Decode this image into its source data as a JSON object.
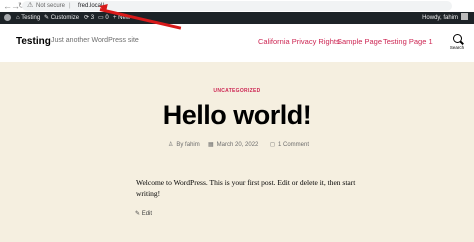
{
  "browser": {
    "back_icon": "←",
    "forward_icon": "→",
    "reload_icon": "↻",
    "lock_icon": "⚠",
    "security_label": "Not secure",
    "url": "fred.local/"
  },
  "admin_bar": {
    "site_name": "Testing",
    "customize": "Customize",
    "updates_count": "3",
    "comments_count": "0",
    "new_label": "+ New",
    "howdy": "Howdy, fahim"
  },
  "header": {
    "site_title": "Testing",
    "tagline": "Just another WordPress site",
    "menu": [
      "California Privacy Rights",
      "Sample Page",
      "Testing Page 1"
    ],
    "search_label": "Search"
  },
  "post": {
    "category": "UNCATEGORIZED",
    "title": "Hello world!",
    "author": "By fahim",
    "date": "March 20, 2022",
    "comments": "1 Comment",
    "content": "Welcome to WordPress. This is your first post. Edit or delete it, then start writing!",
    "edit_label": "Edit"
  },
  "colors": {
    "accent": "#cd2653",
    "annotation_arrow": "#d91a1a",
    "background": "#f5efe0"
  }
}
